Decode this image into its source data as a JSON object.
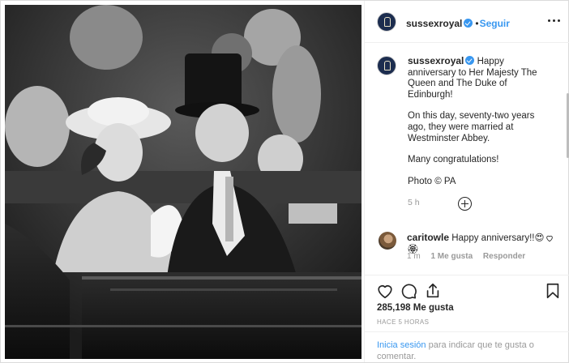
{
  "account": {
    "username": "sussexroyal",
    "verified": true,
    "separator": "•",
    "follow_label": "Seguir"
  },
  "caption": {
    "username": "sussexroyal",
    "paragraphs": [
      "Happy anniversary to Her Majesty The Queen and The Duke of Edinburgh!",
      "On this day, seventy-two years ago, they were married at Westminster Abbey.",
      "Many congratulations!",
      "Photo © PA"
    ],
    "time": "5 h"
  },
  "comment": {
    "username": "caritowle",
    "text": "Happy anniversary!!😍🏵",
    "time": "1 m",
    "likes": "1 Me gusta",
    "reply": "Responder"
  },
  "stats": {
    "likes_count": "285,198",
    "likes_label": "Me gusta",
    "time_ago": "HACE 5 HORAS"
  },
  "login_prompt": {
    "link": "Inicia sesión",
    "text": "para indicar que te gusta o comentar."
  },
  "icons": [
    "more-options-icon",
    "add-comment-icon",
    "heart-icon",
    "comment-icon",
    "share-icon",
    "bookmark-icon"
  ],
  "colors": {
    "link": "#3897f0",
    "muted": "#999999",
    "text": "#262626",
    "avatar": "#1c2d4f"
  }
}
